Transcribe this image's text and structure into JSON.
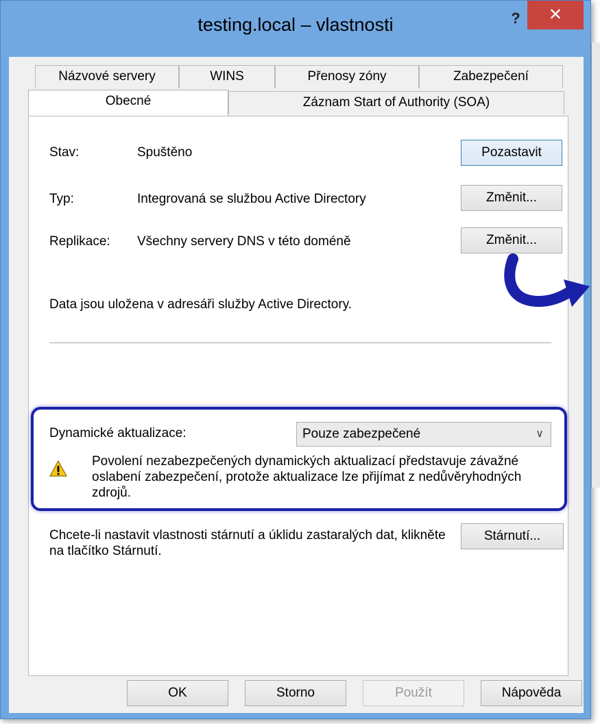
{
  "window": {
    "title": "testing.local – vlastnosti",
    "help_label": "?",
    "close_label": "✕"
  },
  "tabs": {
    "row1": [
      "Názvové servery",
      "WINS",
      "Přenosy zóny",
      "Zabezpečení"
    ],
    "row2": [
      "Obecné",
      "Záznam Start of Authority (SOA)"
    ],
    "active": "Obecné"
  },
  "general": {
    "status_label": "Stav:",
    "status_value": "Spuštěno",
    "pause_button": "Pozastavit",
    "type_label": "Typ:",
    "type_value": "Integrovaná se službou Active Directory",
    "type_change_button": "Změnit...",
    "replication_label": "Replikace:",
    "replication_value": "Všechny servery DNS v této doméně",
    "replication_change_button": "Změnit...",
    "storage_text": "Data jsou uložena v adresáři služby Active Directory."
  },
  "dynamic_updates": {
    "label": "Dynamické aktualizace:",
    "selected": "Pouze zabezpečené",
    "warning": "Povolení nezabezpečených dynamických aktualizací představuje závažné oslabení zabezpečení, protože aktualizace lze přijímat z nedůvěryhodných zdrojů."
  },
  "aging": {
    "text": "Chcete-li nastavit vlastnosti stárnutí a úklidu zastaralých dat, klikněte na tlačítko Stárnutí.",
    "button": "Stárnutí..."
  },
  "footer": {
    "ok": "OK",
    "cancel": "Storno",
    "apply": "Použít",
    "help": "Nápověda"
  },
  "colors": {
    "titlebar": "#71a8e2",
    "close": "#c8453f",
    "highlight": "#1a20a8",
    "arrow": "#1a20a8"
  },
  "icons": {
    "warning": "warning-icon",
    "dropdown": "chevron-down-icon",
    "arrow": "curved-arrow-icon"
  }
}
